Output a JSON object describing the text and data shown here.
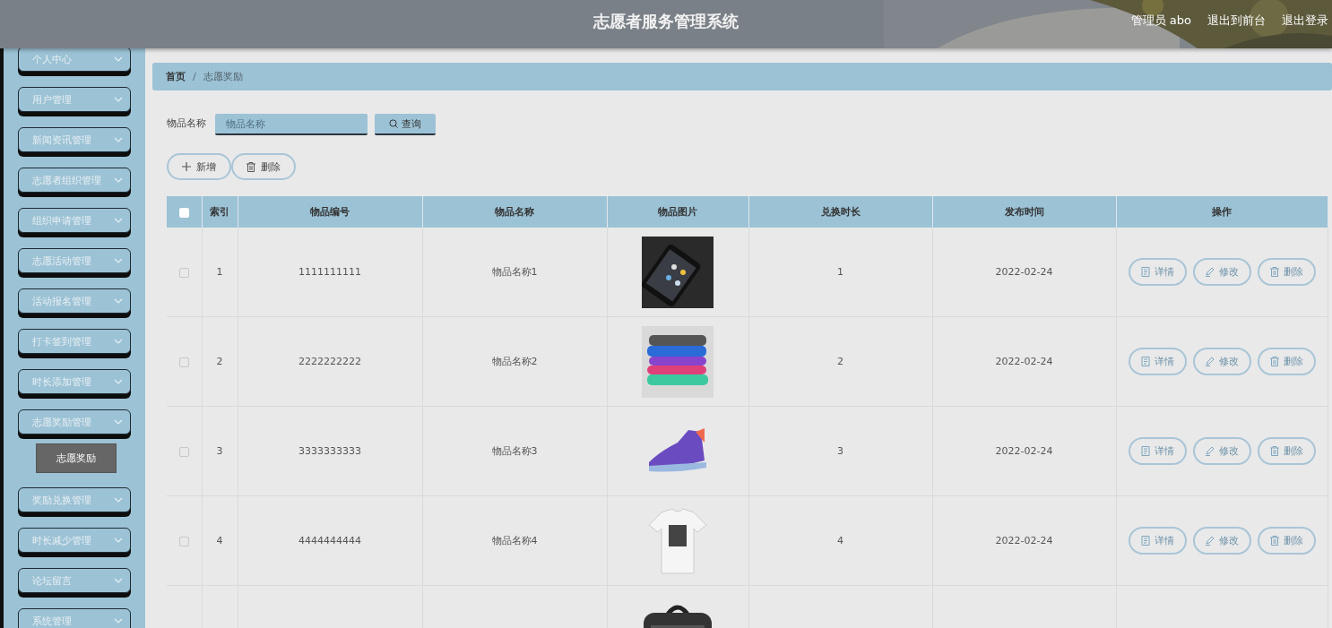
{
  "header": {
    "title": "志愿者服务管理系统",
    "links": [
      "管理员 abo",
      "退出到前台",
      "退出登录"
    ]
  },
  "sidebar": {
    "items": [
      {
        "label": "个人中心"
      },
      {
        "label": "用户管理"
      },
      {
        "label": "新闻资讯管理"
      },
      {
        "label": "志愿者组织管理"
      },
      {
        "label": "组织申请管理"
      },
      {
        "label": "志愿活动管理"
      },
      {
        "label": "活动报名管理"
      },
      {
        "label": "打卡签到管理"
      },
      {
        "label": "时长添加管理"
      },
      {
        "label": "志愿奖励管理",
        "children": [
          {
            "label": "志愿奖励",
            "selected": true
          }
        ]
      },
      {
        "label": "奖励兑换管理"
      },
      {
        "label": "时长减少管理"
      },
      {
        "label": "论坛留言"
      },
      {
        "label": "系统管理"
      }
    ]
  },
  "breadcrumb": {
    "items": [
      "首页",
      "志愿奖励"
    ],
    "separator": "/"
  },
  "search": {
    "label": "物品名称",
    "placeholder": "物品名称",
    "button": "查询"
  },
  "toolbar": [
    {
      "kind": "add",
      "label": "新增"
    },
    {
      "kind": "delete",
      "label": "删除"
    }
  ],
  "table": {
    "header_checked": false,
    "columns": [
      "索引",
      "物品编号",
      "物品名称",
      "物品图片",
      "兑换时长",
      "发布时间",
      "操作"
    ],
    "rows": [
      {
        "checked": false,
        "index": "1",
        "code": "1111111111",
        "name": "物品名称1",
        "picture": {
          "kind": "picture"
        },
        "duration": "1",
        "published": "2022-02-24",
        "actions": [
          {
            "kind": "detail",
            "label": "详情"
          },
          {
            "kind": "edit",
            "label": "修改"
          },
          {
            "kind": "delete",
            "label": "删除"
          }
        ]
      },
      {
        "checked": false,
        "index": "2",
        "code": "2222222222",
        "name": "物品名称2",
        "picture": {
          "kind": "picture"
        },
        "duration": "2",
        "published": "2022-02-24",
        "actions": [
          {
            "kind": "detail",
            "label": "详情"
          },
          {
            "kind": "edit",
            "label": "修改"
          },
          {
            "kind": "delete",
            "label": "删除"
          }
        ]
      },
      {
        "checked": false,
        "index": "3",
        "code": "3333333333",
        "name": "物品名称3",
        "picture": {
          "kind": "picture"
        },
        "duration": "3",
        "published": "2022-02-24",
        "actions": [
          {
            "kind": "detail",
            "label": "详情"
          },
          {
            "kind": "edit",
            "label": "修改"
          },
          {
            "kind": "delete",
            "label": "删除"
          }
        ]
      },
      {
        "checked": false,
        "index": "4",
        "code": "4444444444",
        "name": "物品名称4",
        "picture": {
          "kind": "picture"
        },
        "duration": "4",
        "published": "2022-02-24",
        "actions": [
          {
            "kind": "detail",
            "label": "详情"
          },
          {
            "kind": "edit",
            "label": "修改"
          },
          {
            "kind": "delete",
            "label": "删除"
          }
        ]
      },
      {
        "picture": {
          "kind": "picture"
        }
      }
    ]
  }
}
